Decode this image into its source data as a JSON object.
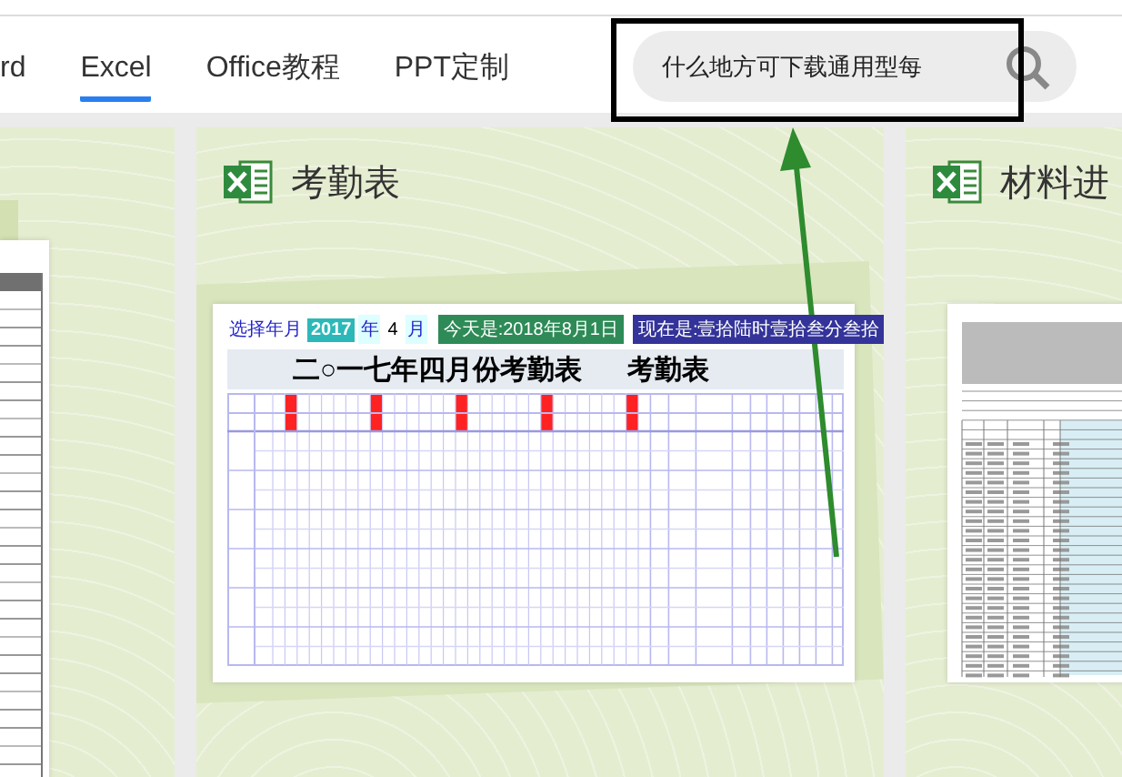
{
  "nav": {
    "tabs": [
      {
        "label": "rd",
        "selected": false
      },
      {
        "label": "Excel",
        "selected": true
      },
      {
        "label": "Office教程",
        "selected": false
      },
      {
        "label": "PPT定制",
        "selected": false
      }
    ]
  },
  "search": {
    "value": "什么地方可下载通用型每"
  },
  "cards": [
    {
      "kind": "table"
    },
    {
      "kind": "attendance",
      "title": "考勤表",
      "preview": {
        "picker_label": "选择年月",
        "year": "2017",
        "year_unit": "年",
        "month": "4",
        "month_unit": "月",
        "today": "今天是:2018年8月1日",
        "now": "现在是:壹拾陆时壹拾叁分叁拾",
        "heading": "二○一七年四月份考勤表",
        "side_heading": "考勤表"
      }
    },
    {
      "kind": "materials",
      "title": "材料进"
    }
  ]
}
